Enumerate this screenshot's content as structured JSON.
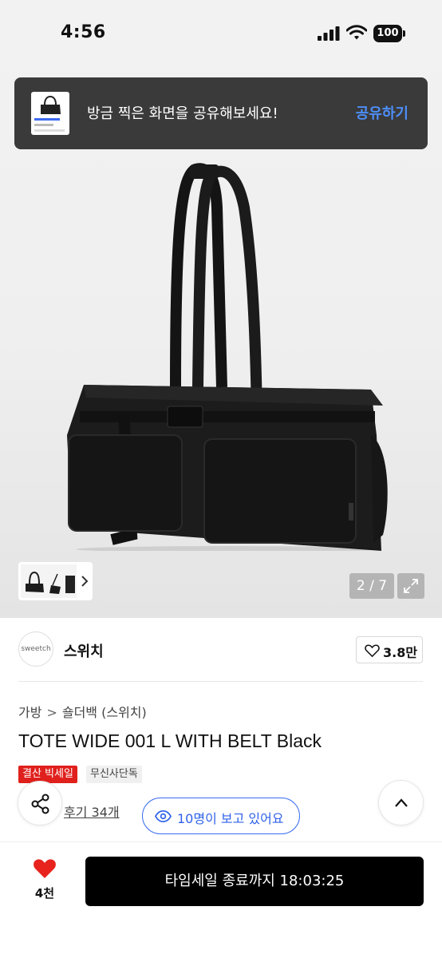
{
  "status_bar": {
    "time": "4:56",
    "battery": "100"
  },
  "toast": {
    "message": "방금 찍은 화면을 공유해보세요!",
    "action": "공유하기"
  },
  "gallery": {
    "counter": "2 / 7"
  },
  "brand": {
    "logo_text": "sweetch",
    "name": "스위치",
    "likes": "3.8만"
  },
  "breadcrumb": {
    "category": "가방",
    "sep": ">",
    "subcategory": "숄더백 (스위치)"
  },
  "product": {
    "title": "TOTE WIDE 001 L WITH BELT Black",
    "badge_sale": "결산 빅세일",
    "badge_exclusive": "무신사단독",
    "reviews": "후기 34개",
    "viewers": "10명이 보고 있어요"
  },
  "bottom": {
    "wish_count": "4천",
    "buy_label": "타임세일 종료까지 18:03:25"
  },
  "colors": {
    "accent_blue": "#3b6df2",
    "sale_red": "#e0201c",
    "heart_red": "#e8231d"
  },
  "icons": [
    "cellular-signal-icon",
    "wifi-icon",
    "battery-icon",
    "chevron-right-icon",
    "expand-icon",
    "heart-outline-icon",
    "share-icon",
    "eye-icon",
    "chevron-up-icon",
    "heart-filled-icon"
  ]
}
